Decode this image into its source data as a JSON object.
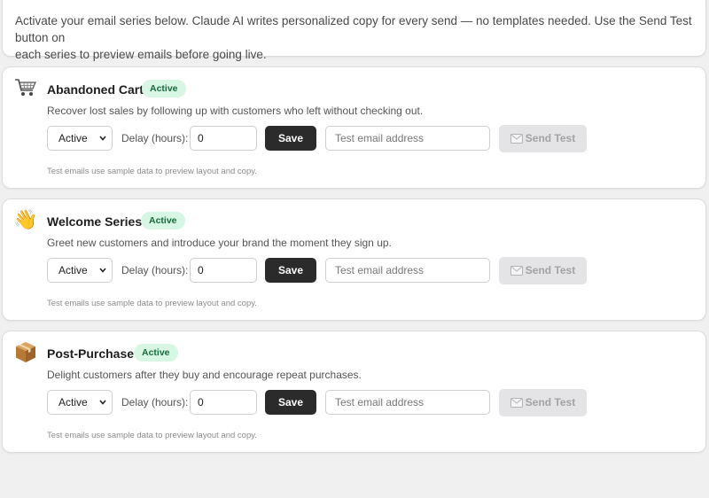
{
  "intro": {
    "line1": "Activate your email series below. Claude AI writes personalized copy for every send — no templates needed. Use the Send Test button on",
    "line2": "each series to preview emails before going live."
  },
  "common": {
    "delay_label": "Delay (hours):",
    "save_label": "Save",
    "email_placeholder": "Test email address",
    "send_test_label": "Send Test",
    "note": "Test emails use sample data to preview layout and copy.",
    "send_test_icon": "envelope-icon",
    "select_icon": "chevron-down-icon"
  },
  "series": [
    {
      "icon": "shopping-cart-icon",
      "title": "Abandoned Cart",
      "badge": "Active",
      "description": "Recover lost sales by following up with customers who left without checking out.",
      "status_value": "Active",
      "delay_hours": "0"
    },
    {
      "icon": "waving-hand-icon",
      "emoji": "👋",
      "title": "Welcome Series",
      "badge": "Active",
      "description": "Greet new customers and introduce your brand the moment they sign up.",
      "status_value": "Active",
      "delay_hours": "0"
    },
    {
      "icon": "package-icon",
      "title": "Post-Purchase",
      "badge": "Active",
      "description": "Delight customers after they buy and encourage repeat purchases.",
      "status_value": "Active",
      "delay_hours": "0"
    }
  ],
  "colors": {
    "badge_bg": "#d7f6e4",
    "badge_text": "#176b3c",
    "save_bg": "#2b2b2b",
    "send_test_bg": "#e4e4e6"
  }
}
